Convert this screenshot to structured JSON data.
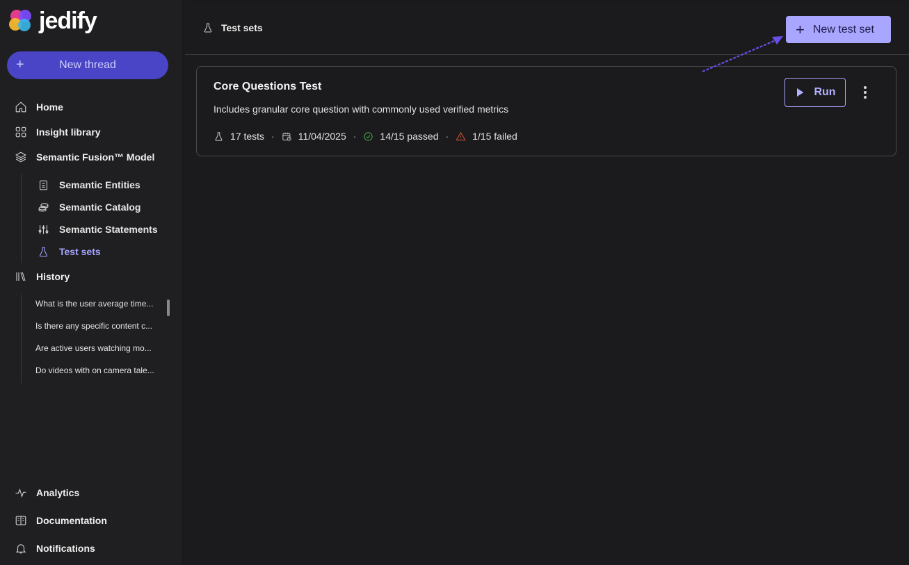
{
  "app": {
    "name": "jedify"
  },
  "sidebar": {
    "new_thread": "New thread",
    "nav": {
      "home": "Home",
      "insight_library": "Insight library",
      "semantic_fusion": "Semantic Fusion™ Model",
      "history": "History",
      "analytics": "Analytics",
      "documentation": "Documentation",
      "notifications": "Notifications"
    },
    "sub_items": [
      {
        "label": "Semantic Entities",
        "icon": "document-icon"
      },
      {
        "label": "Semantic Catalog",
        "icon": "coins-icon"
      },
      {
        "label": "Semantic Statements",
        "icon": "sliders-icon"
      },
      {
        "label": "Test sets",
        "icon": "flask-icon",
        "active": true
      }
    ],
    "history": [
      "What is the user average time...",
      "Is there any specific content c...",
      "Are active users watching mo...",
      "Do videos with on camera tale..."
    ]
  },
  "header": {
    "breadcrumb": "Test sets",
    "new_test_set": "New test set"
  },
  "test_set": {
    "title": "Core Questions Test",
    "description": "Includes granular core question with commonly used verified metrics",
    "tests": "17 tests",
    "date": "11/04/2025",
    "passed": "14/15 passed",
    "failed": "1/15 failed",
    "run": "Run"
  },
  "colors": {
    "accent": "#a9a6ff",
    "new_thread_bg": "#4a44c6",
    "passed": "#4caf50",
    "failed": "#e05a3a"
  }
}
